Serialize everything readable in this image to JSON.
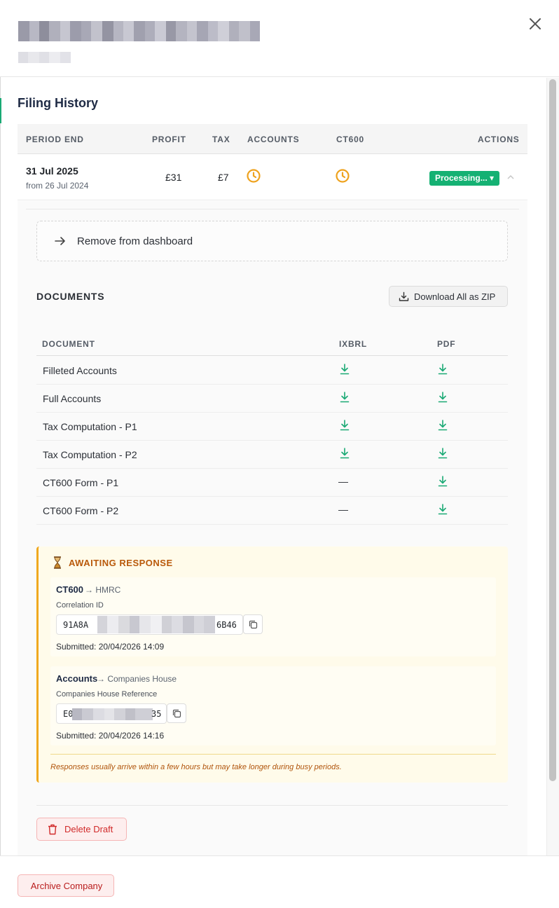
{
  "dialog": {
    "close_icon": "close-icon"
  },
  "filing_history": {
    "title": "Filing History",
    "columns": [
      "PERIOD END",
      "PROFIT",
      "TAX",
      "ACCOUNTS",
      "CT600",
      "ACTIONS"
    ],
    "row": {
      "period_end": "31 Jul 2025",
      "period_from": "from 26 Jul 2024",
      "profit": "£31",
      "tax": "£7",
      "accounts_status_icon": "clock-icon",
      "ct600_status_icon": "clock-icon",
      "action_label": "Processing... ▾"
    }
  },
  "expanded": {
    "remove_label": "Remove from dashboard",
    "documents_title": "DOCUMENTS",
    "download_zip_label": "Download All as ZIP",
    "doc_columns": [
      "DOCUMENT",
      "IXBRL",
      "PDF"
    ],
    "documents": [
      {
        "name": "Filleted Accounts",
        "ixbrl": "download",
        "pdf": "download"
      },
      {
        "name": "Full Accounts",
        "ixbrl": "download",
        "pdf": "download"
      },
      {
        "name": "Tax Computation - P1",
        "ixbrl": "download",
        "pdf": "download"
      },
      {
        "name": "Tax Computation - P2",
        "ixbrl": "download",
        "pdf": "download"
      },
      {
        "name": "CT600 Form - P1",
        "ixbrl": "—",
        "pdf": "download"
      },
      {
        "name": "CT600 Form - P2",
        "ixbrl": "—",
        "pdf": "download"
      }
    ],
    "awaiting": {
      "title": "AWAITING RESPONSE",
      "ct600": {
        "title": "CT600",
        "destination": "→ HMRC",
        "label": "Correlation ID",
        "ref_start": "91A8A",
        "ref_end": "6B46",
        "submitted": "Submitted: 20/04/2026 14:09"
      },
      "accounts": {
        "title": "Accounts",
        "destination": "→ Companies House",
        "label": "Companies House Reference",
        "ref_start": "E0",
        "ref_end": "35",
        "submitted": "Submitted: 20/04/2026 14:16"
      },
      "note": "Responses usually arrive within a few hours but may take longer during busy periods."
    },
    "delete_label": "Delete Draft"
  },
  "footer": {
    "archive_label": "Archive Company"
  },
  "colors": {
    "accent_green": "#15b173",
    "warning_orange": "#f0a81e",
    "danger_red": "#d12a2a"
  }
}
